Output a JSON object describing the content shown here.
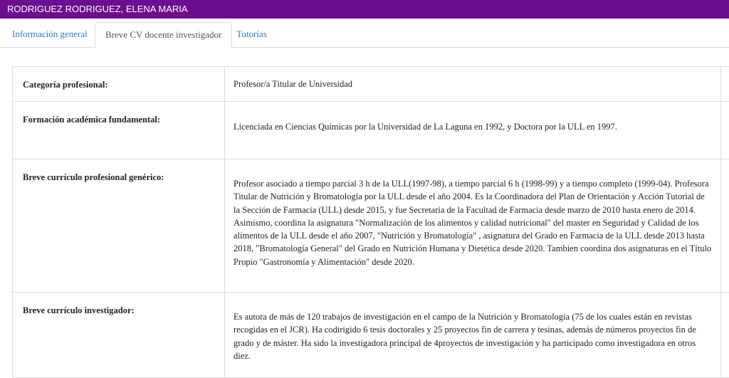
{
  "header": {
    "title": "RODRIGUEZ RODRIGUEZ, ELENA MARIA"
  },
  "tabs": [
    {
      "label": "Información general"
    },
    {
      "label": "Breve CV docente investigador"
    },
    {
      "label": "Tutorías"
    }
  ],
  "rows": [
    {
      "label": "Categoría profesional:",
      "value": "Profesor/a Titular de Universidad"
    },
    {
      "label": "Formación académica fundamental:",
      "value": "Licenciada en Ciencias Químicas por la Universidad de La Laguna en 1992, y Doctora por la ULL en 1997."
    },
    {
      "label": "Breve currículo profesional genérico:",
      "value": "Profesor asociado a tiempo parcial 3 h de la ULL(1997-98), a tiempo parcial 6 h (1998-99) y a tiempo completo (1999-04). Profesora Titular de Nutrición y Bromatología por la ULL desde el año 2004. Es la Coordinadora del Plan de Orientación y Acción Tutorial de la Sección de Farmacia (ULL) desde 2015, y fue Secretaria de la Facultad de Farmacia desde marzo de 2010 hasta enero de 2014. Asimismo, coordina la asignatura  \"Normalización de los alimentos y calidad nutricional\" del master en Seguridad y Calidad de los alimentos de la ULL desde el año 2007, \"Nutrición y Bromatología\" , asignatura del Grado en Farmacia de la ULL desde 2013 hasta 2018, \"Bromatología General\" del Grado en Nutrición Humana y Dietética desde 2020. Tambien coordina dos asignaturas en el Título Propio \"Gastronomía y Alimentación\" desde 2020."
    },
    {
      "label": "Breve currículo investigador:",
      "value": "Es autora de más de 120 trabajos de investigación en el campo de la Nutrición y Bromatología (75 de los cuales están en revistas recogidas en el JCR). Ha codirigido 6 tesis doctorales y 25 proyectos fin de carrera y tesinas, además de números proyectos fin de grado y de máster. Ha sido la investigadora principal de 4proyectos de investigación y ha participado como investigadora en otros diez."
    }
  ]
}
